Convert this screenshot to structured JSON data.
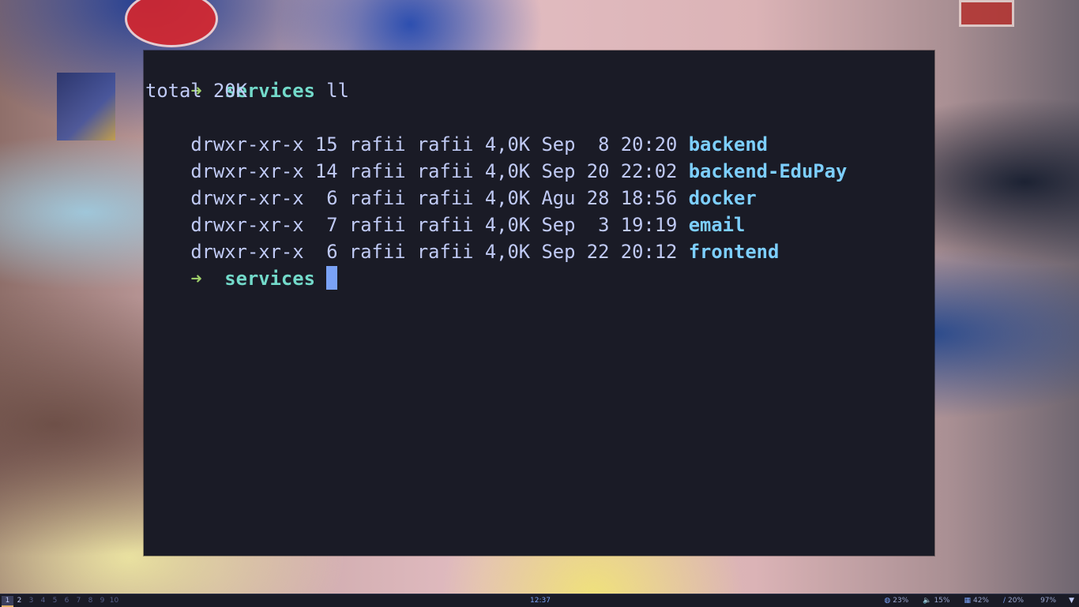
{
  "terminal": {
    "lines": [
      {
        "kind": "prompt",
        "arrow": "➜",
        "cwd": "services",
        "command": "ll"
      },
      {
        "kind": "text",
        "text": "total 20K"
      },
      {
        "kind": "entry",
        "meta": "drwxr-xr-x 15 rafii rafii 4,0K Sep  8 20:20",
        "name": "backend"
      },
      {
        "kind": "entry",
        "meta": "drwxr-xr-x 14 rafii rafii 4,0K Sep 20 22:02",
        "name": "backend-EduPay"
      },
      {
        "kind": "entry",
        "meta": "drwxr-xr-x  6 rafii rafii 4,0K Agu 28 18:56",
        "name": "docker"
      },
      {
        "kind": "entry",
        "meta": "drwxr-xr-x  7 rafii rafii 4,0K Sep  3 19:19",
        "name": "email"
      },
      {
        "kind": "entry",
        "meta": "drwxr-xr-x  6 rafii rafii 4,0K Sep 22 20:12",
        "name": "frontend"
      },
      {
        "kind": "prompt-active",
        "arrow": "➜",
        "cwd": "services",
        "command": ""
      }
    ]
  },
  "statusbar": {
    "workspaces": [
      "1",
      "2",
      "3",
      "4",
      "5",
      "6",
      "7",
      "8",
      "9",
      "10"
    ],
    "active_workspace": "1",
    "clock": "12:37",
    "tray": [
      {
        "icon": "cpu-icon",
        "value": "23%"
      },
      {
        "icon": "volume-icon",
        "value": "15%"
      },
      {
        "icon": "memory-icon",
        "value": "42%"
      },
      {
        "icon": "disk-icon",
        "value": "20%"
      },
      {
        "icon": "battery-icon",
        "value": "97%"
      }
    ],
    "tray_glyphs": {
      "cpu-icon": "◍",
      "volume-icon": "🔈",
      "memory-icon": "▦",
      "disk-icon": "/",
      "battery-icon": ""
    },
    "menu_icon": "▼"
  }
}
